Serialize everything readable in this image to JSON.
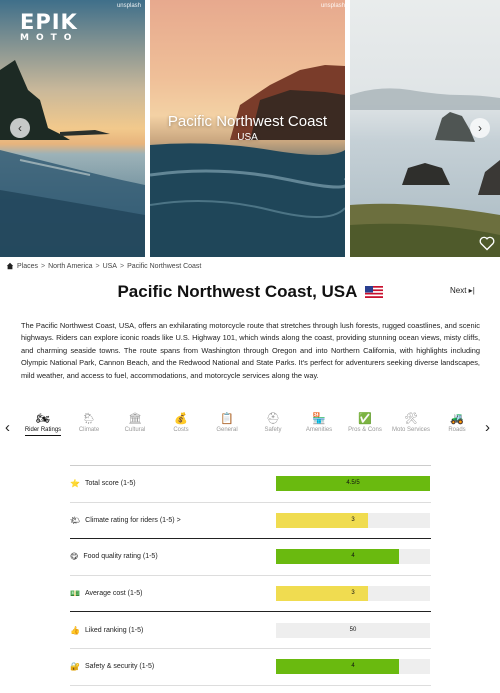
{
  "brand": {
    "logo_line1": "EPIK",
    "logo_line2": "MOTO"
  },
  "gallery": {
    "photo_credit": "unsplash",
    "photo_credit_2": "unsplash",
    "hero_title": "Pacific Northwest Coast",
    "hero_subtitle": "USA"
  },
  "breadcrumb": [
    "Places",
    "North America",
    "USA",
    "Pacific Northwest Coast"
  ],
  "breadcrumb_separator": ">",
  "page": {
    "title": "Pacific Northwest Coast, USA",
    "next_label": "Next ▸|",
    "description": "The Pacific Northwest Coast, USA, offers an exhilarating motorcycle route that stretches through lush forests, rugged coastlines, and scenic highways. Riders can explore iconic roads like U.S. Highway 101, which winds along the coast, providing stunning ocean views, misty cliffs, and charming seaside towns. The route spans from Washington through Oregon and into Northern California, with highlights including Olympic National Park, Cannon Beach, and the Redwood National and State Parks. It's perfect for adventurers seeking diverse landscapes, mild weather, and access to fuel, accommodations, and motorcycle services along the way."
  },
  "tabs": [
    {
      "label": "Rider Ratings",
      "icon": "motorcycle-icon",
      "glyph": "🏍",
      "active": true
    },
    {
      "label": "Climate",
      "icon": "weather-icon",
      "glyph": "🌦",
      "active": false
    },
    {
      "label": "Cultural",
      "icon": "museum-icon",
      "glyph": "🏛",
      "active": false
    },
    {
      "label": "Costs",
      "icon": "money-bag-icon",
      "glyph": "💰",
      "active": false
    },
    {
      "label": "General",
      "icon": "clipboard-icon",
      "glyph": "📋",
      "active": false
    },
    {
      "label": "Safety",
      "icon": "lifebuoy-icon",
      "glyph": "⛑",
      "active": false
    },
    {
      "label": "Amenities",
      "icon": "store-icon",
      "glyph": "🏪",
      "active": false
    },
    {
      "label": "Pros & Cons",
      "icon": "check-icon",
      "glyph": "✅",
      "active": false
    },
    {
      "label": "Moto Services",
      "icon": "tools-icon",
      "glyph": "🛠",
      "active": false
    },
    {
      "label": "Roads",
      "icon": "road-icon",
      "glyph": "🚜",
      "active": false
    }
  ],
  "ratings": [
    {
      "label": "Total score (1-5)",
      "emoji": "⭐",
      "value": "4.5/5",
      "fraction": 1.0,
      "color": "#6aba0f"
    },
    {
      "label": "Climate rating for riders (1-5) >",
      "emoji": "🌤",
      "value": "3",
      "fraction": 0.6,
      "color": "#f0dc50"
    },
    {
      "label": "Food quality rating (1-5)",
      "emoji": "😋",
      "value": "4",
      "fraction": 0.8,
      "color": "#6aba0f"
    },
    {
      "label": "Average cost (1-5)",
      "emoji": "💵",
      "value": "3",
      "fraction": 0.6,
      "color": "#f0dc50"
    },
    {
      "label": "Liked ranking (1-5)",
      "emoji": "👍",
      "value": "50",
      "fraction": 0.0,
      "color": "#6aba0f"
    },
    {
      "label": "Safety & security (1-5)",
      "emoji": "🔐",
      "value": "4",
      "fraction": 0.8,
      "color": "#6aba0f"
    }
  ],
  "colors": {
    "green": "#6aba0f",
    "yellow": "#f0dc50",
    "bar_track": "#eeeeee"
  }
}
